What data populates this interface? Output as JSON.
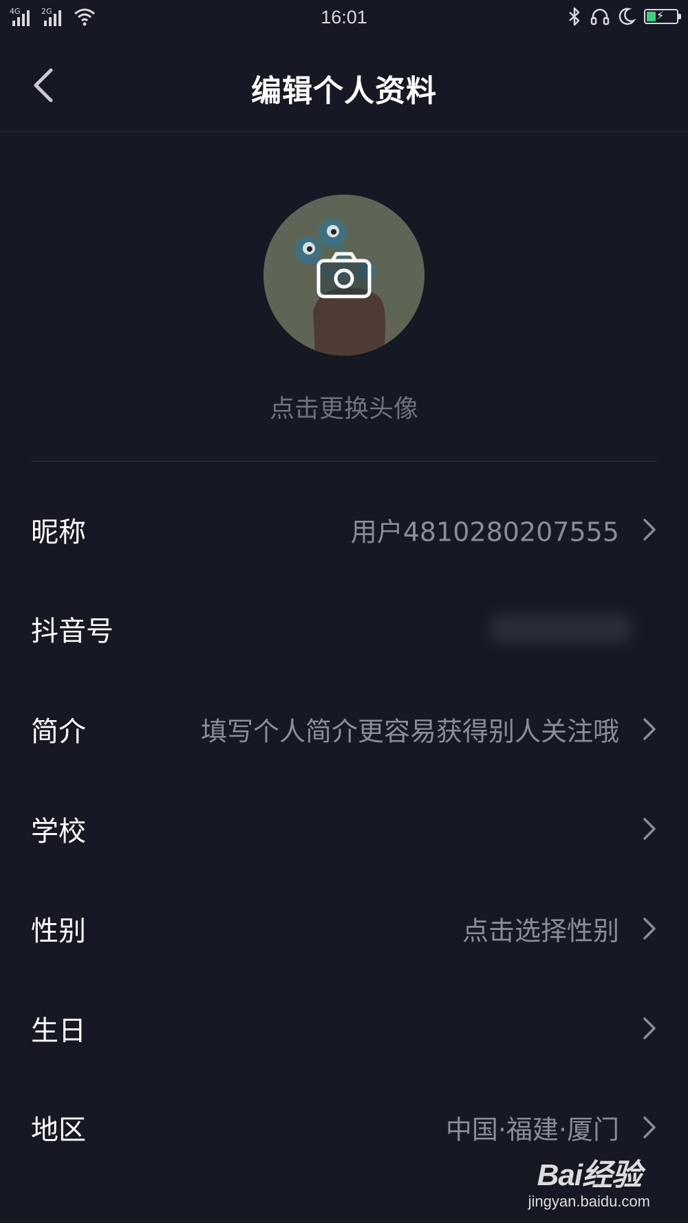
{
  "status_bar": {
    "network_1": "4G",
    "network_2": "2G",
    "time": "16:01",
    "icons": [
      "bluetooth-icon",
      "headset-icon",
      "moon-icon",
      "battery-charging-icon"
    ],
    "battery_level": 0.3,
    "battery_color": "#3fd07a"
  },
  "header": {
    "title": "编辑个人资料",
    "back_icon": "chevron-left-icon"
  },
  "avatar": {
    "camera_icon": "camera-icon",
    "caption": "点击更换头像"
  },
  "rows": [
    {
      "label": "昵称",
      "value": "用户4810280207555",
      "has_chevron": true
    },
    {
      "label": "抖音号",
      "value": "",
      "blurred": true,
      "has_chevron": false
    },
    {
      "label": "简介",
      "value": "填写个人简介更容易获得别人关注哦",
      "has_chevron": true
    },
    {
      "label": "学校",
      "value": "",
      "has_chevron": true
    },
    {
      "label": "性别",
      "value": "点击选择性别",
      "has_chevron": true
    },
    {
      "label": "生日",
      "value": "",
      "has_chevron": true
    },
    {
      "label": "地区",
      "value": "中国·福建·厦门",
      "has_chevron": true
    }
  ],
  "watermark": {
    "logo_text": "Bai经验",
    "url": "jingyan.baidu.com"
  },
  "colors": {
    "background": "#161823",
    "divider": "#2a2c36",
    "secondary_text": "#8b8d96",
    "caption_text": "#6f717c"
  }
}
